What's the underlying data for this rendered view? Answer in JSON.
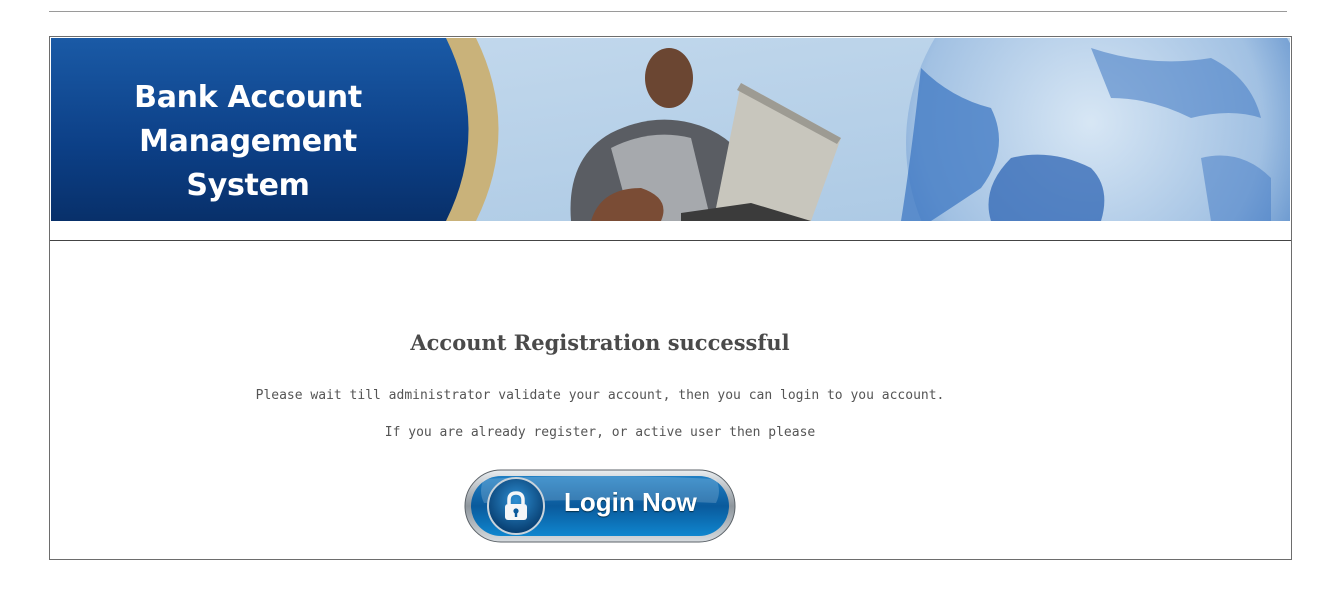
{
  "header": {
    "title_line1": "Bank Account",
    "title_line2": "Management System",
    "banner_image": "student-with-laptop-and-globe"
  },
  "main": {
    "heading": "Account Registration successful",
    "message_line1": "Please wait till administrator validate your account, then you can login to you account.",
    "message_line2": "If you are already register, or active user then please"
  },
  "login_button": {
    "label": "Login Now",
    "icon": "lock-icon"
  },
  "colors": {
    "banner_blue": "#0c3f86",
    "banner_gold": "#c9b27a",
    "button_blue": "#0a5a9c",
    "heading_gray": "#4a4a4a"
  }
}
